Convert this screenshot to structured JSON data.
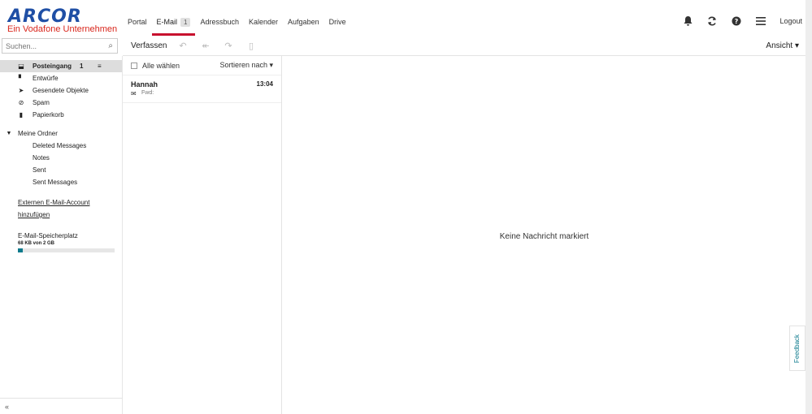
{
  "logo": {
    "brand": "ARCOR",
    "tagline": "Ein Vodafone Unternehmen"
  },
  "nav": {
    "tabs": [
      {
        "label": "Portal"
      },
      {
        "label": "E-Mail",
        "badge": "1"
      },
      {
        "label": "Adressbuch"
      },
      {
        "label": "Kalender"
      },
      {
        "label": "Aufgaben"
      },
      {
        "label": "Drive"
      }
    ],
    "logout": "Logout"
  },
  "search": {
    "placeholder": "Suchen..."
  },
  "toolbar": {
    "compose": "Verfassen",
    "view": "Ansicht ▾"
  },
  "folders": [
    {
      "icon": "inbox-icon",
      "glyph": "⬓",
      "label": "Posteingang",
      "count": "1"
    },
    {
      "icon": "draft-icon",
      "glyph": "▘",
      "label": "Entwürfe"
    },
    {
      "icon": "send-icon",
      "glyph": "➤",
      "label": "Gesendete Objekte"
    },
    {
      "icon": "spam-icon",
      "glyph": "⊘",
      "label": "Spam"
    },
    {
      "icon": "trash-icon",
      "glyph": "▮",
      "label": "Papierkorb"
    }
  ],
  "my_folders": {
    "label": "Meine Ordner",
    "items": [
      "Deleted Messages",
      "Notes",
      "Sent",
      "Sent Messages"
    ]
  },
  "external_link": "Externen E-Mail-Account hinzufügen",
  "quota": {
    "label": "E-Mail-Speicherplatz",
    "value": "68 KB von 2 GB",
    "fraction": 0.05
  },
  "list": {
    "select_all": "Alle wählen",
    "sort": "Sortieren nach ▾",
    "messages": [
      {
        "from": "Hannah",
        "time": "13:04",
        "subject": "Fwd:"
      }
    ]
  },
  "detail": {
    "empty_text": "Keine Nachricht markiert"
  },
  "feedback": "Feedback",
  "collapse": "«"
}
